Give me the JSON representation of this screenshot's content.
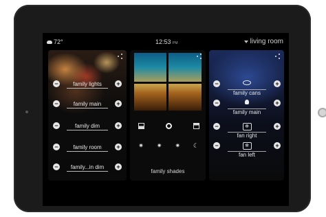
{
  "status_bar": {
    "weather_temp": "72°",
    "time": "12:53",
    "time_suffix": "PM",
    "room": "living room"
  },
  "lights": {
    "items": [
      {
        "label": "family lights"
      },
      {
        "label": "family main"
      },
      {
        "label": "family dim"
      },
      {
        "label": "family room"
      },
      {
        "label": "family...in dim"
      }
    ],
    "minus_symbol": "−",
    "plus_symbol": "+"
  },
  "shades": {
    "label": "family shades",
    "row1": [
      "shade-open-bottom-icon",
      "shade-stop-icon",
      "shade-open-top-icon"
    ],
    "row2": [
      "sun-icon",
      "sun-icon",
      "sun-icon",
      "moon-icon"
    ]
  },
  "devices": {
    "items": [
      {
        "label": "family cans",
        "icon": "recessed-light-icon"
      },
      {
        "label": "family main",
        "icon": "bulb-icon"
      },
      {
        "label": "fan right",
        "icon": "fan-icon"
      },
      {
        "label": "fan left",
        "icon": "fan-icon"
      }
    ]
  },
  "colors": {
    "screen_bg": "#000000",
    "text": "#e6e6e6",
    "button": "#e6e6e6"
  }
}
